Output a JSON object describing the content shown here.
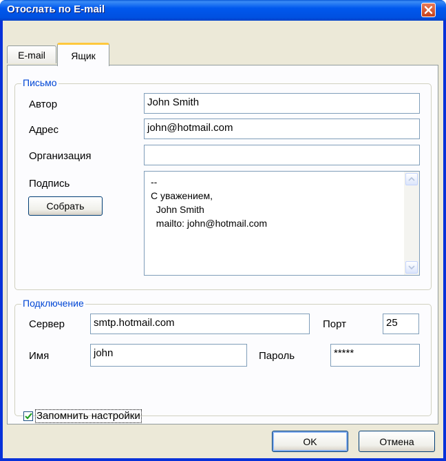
{
  "window": {
    "title": "Отослать по E-mail"
  },
  "tabs": [
    {
      "label": "E-mail",
      "active": false
    },
    {
      "label": "Ящик",
      "active": true
    }
  ],
  "letter": {
    "group_title": "Письмо",
    "author_label": "Автор",
    "author_value": "John Smith",
    "address_label": "Адрес",
    "address_value": "john@hotmail.com",
    "organization_label": "Организация",
    "organization_value": "",
    "signature_label": "Подпись",
    "collect_button": "Собрать",
    "signature_lines": [
      "--",
      "С уважением,",
      "  John Smith",
      "  mailto: john@hotmail.com"
    ]
  },
  "connection": {
    "group_title": "Подключение",
    "server_label": "Сервер",
    "server_value": "smtp.hotmail.com",
    "port_label": "Порт",
    "port_value": "25",
    "name_label": "Имя",
    "name_value": "john",
    "password_label": "Пароль",
    "password_value": "*****"
  },
  "remember": {
    "label": "Запомнить настройки",
    "checked": true
  },
  "buttons": {
    "ok": "OK",
    "cancel": "Отмена"
  },
  "colors": {
    "titlebar": "#0058ee",
    "group_title": "#0046d5",
    "check": "#21a121",
    "close": "#c6411c"
  },
  "icons": [
    "close-icon",
    "checkmark-icon",
    "scroll-up-icon",
    "scroll-down-icon"
  ]
}
